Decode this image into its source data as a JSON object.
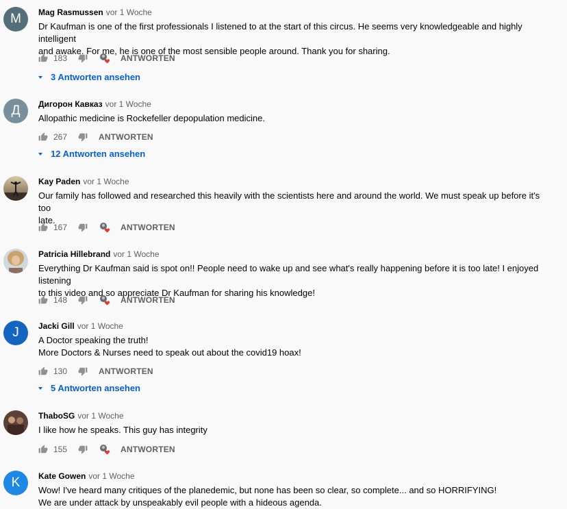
{
  "reply_label": "ANTWORTEN",
  "comments": [
    {
      "author": "Mag Rasmussen",
      "time": "vor 1 Woche",
      "text": "Dr Kaufman is one of the first professionals I listened to at the start of this circus. He seems very knowledgeable and highly intelligent\nand awake. For me, he is one of the most sensible people around. Thank you for sharing.",
      "likes": "183",
      "avatar_letter": "M",
      "avatar_color": "#546e7a",
      "view_replies": "3 Antworten ansehen"
    },
    {
      "author": "Дигорон Кавказ",
      "time": "vor 1 Woche",
      "text": "Allopathic medicine is Rockefeller depopulation medicine.",
      "likes": "267",
      "avatar_letter": "Д",
      "avatar_color": "#78909c",
      "view_replies": "12 Antworten ansehen"
    },
    {
      "author": "Kay Paden",
      "time": "vor 1 Woche",
      "text": "Our family has followed and researched this heavily with the scientists here and around the world. We must speak up before it's too\nlate.",
      "likes": "167"
    },
    {
      "author": "Patricia Hillebrand",
      "time": "vor 1 Woche",
      "text": "Everything Dr Kaufman said is spot on!! People need to wake up and see what's really happening before it is too late! I enjoyed listening\nto this video and so appreciate Dr Kaufman for sharing his knowledge!",
      "likes": "148"
    },
    {
      "author": "Jacki Gill",
      "time": "vor 1 Woche",
      "text": "A Doctor speaking the truth!\nMore Doctors & Nurses need to speak out about the covid19 hoax!",
      "likes": "130",
      "avatar_letter": "J",
      "avatar_color": "#1565c0",
      "view_replies": "5 Antworten ansehen"
    },
    {
      "author": "ThaboSG",
      "time": "vor 1 Woche",
      "text": "I like how he speaks. This guy has integrity",
      "likes": "155"
    },
    {
      "author": "Kate Gowen",
      "time": "vor 1 Woche",
      "text": "Wow! I've heard many critiques of the planedemic, but none has been so clear, so complete... and so HORRIFYING!\nWe are under attack by unspeakably evil people with a  hideous agenda.",
      "avatar_letter": "K",
      "avatar_color": "#1e88e5"
    }
  ]
}
